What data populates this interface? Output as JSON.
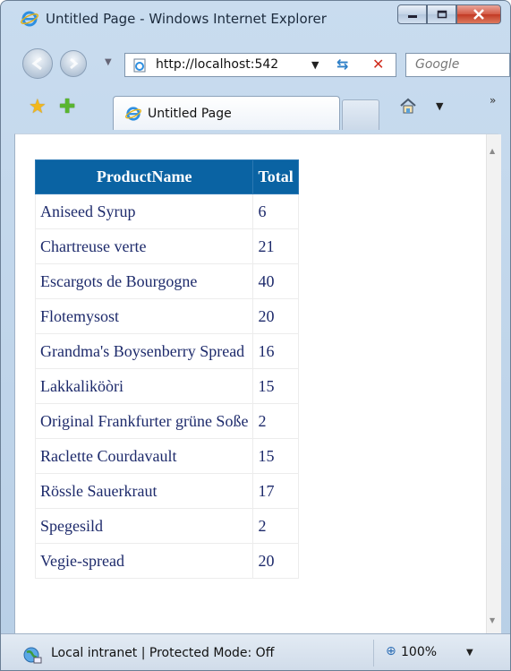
{
  "window": {
    "title": "Untitled Page - Windows Internet Explorer"
  },
  "address": {
    "url": "http://localhost:542"
  },
  "search": {
    "placeholder": "Google"
  },
  "tab": {
    "label": "Untitled Page"
  },
  "grid": {
    "headers": [
      "ProductName",
      "Total"
    ],
    "rows": [
      [
        "Aniseed Syrup",
        "6"
      ],
      [
        "Chartreuse verte",
        "21"
      ],
      [
        "Escargots de Bourgogne",
        "40"
      ],
      [
        "Flotemysost",
        "20"
      ],
      [
        "Grandma's Boysenberry Spread",
        "16"
      ],
      [
        "Lakkaliköòri",
        "15"
      ],
      [
        "Original Frankfurter grüne Soße",
        "2"
      ],
      [
        "Raclette Courdavault",
        "15"
      ],
      [
        "Rössle Sauerkraut",
        "17"
      ],
      [
        "Spegesild",
        "2"
      ],
      [
        "Vegie-spread",
        "20"
      ]
    ]
  },
  "status": {
    "zone": "Local intranet | Protected Mode: Off",
    "zoom": "100%"
  },
  "colors": {
    "header_bg": "#0a63a3",
    "link_text": "#1d2a6b"
  },
  "icons": {
    "ie_logo": "ie-logo-icon",
    "back": "back-arrow-icon",
    "forward": "forward-arrow-icon",
    "refresh": "refresh-icon",
    "stop": "stop-icon",
    "favorites": "star-icon",
    "add_favorites": "add-favorite-icon",
    "home": "home-icon",
    "zone": "globe-icon"
  }
}
